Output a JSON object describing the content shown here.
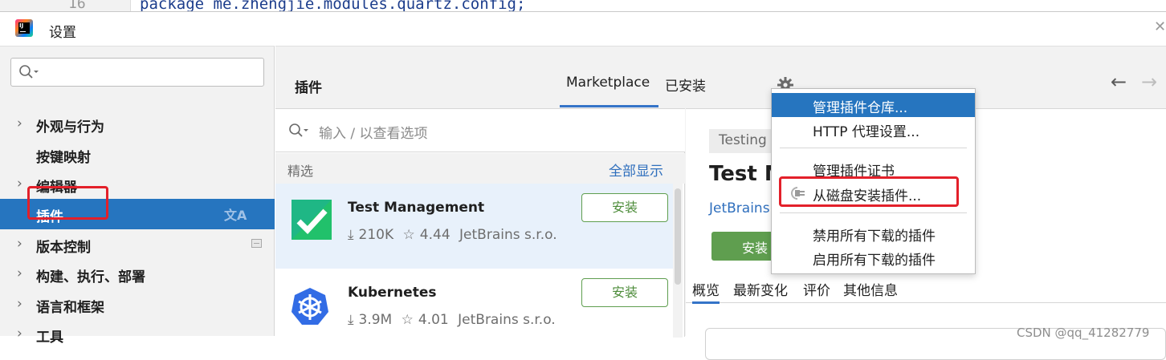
{
  "editor": {
    "line_number": "16",
    "code_line": "package me.zhengjie.modules.quartz.config;"
  },
  "window": {
    "title": "设置",
    "app_icon": "intellij-idea-icon",
    "app_icon_text": "IJ"
  },
  "sidebar": {
    "search_icon": "search-icon",
    "items": [
      {
        "label": "外观与行为",
        "expandable": true
      },
      {
        "label": "按键映射",
        "expandable": false
      },
      {
        "label": "编辑器",
        "expandable": true
      },
      {
        "label": "插件",
        "expandable": false,
        "selected": true
      },
      {
        "label": "版本控制",
        "expandable": true
      },
      {
        "label": "构建、执行、部署",
        "expandable": true
      },
      {
        "label": "语言和框架",
        "expandable": true
      },
      {
        "label": "工具",
        "expandable": true
      }
    ]
  },
  "plugins": {
    "title": "插件",
    "tabs": [
      {
        "label": "Marketplace",
        "active": true
      },
      {
        "label": "已安装",
        "active": false
      }
    ],
    "search_placeholder": "输入 / 以查看选项",
    "section_title": "精选",
    "section_link": "全部显示",
    "list": [
      {
        "name": "Test Management",
        "downloads": "210K",
        "rating": "4.44",
        "vendor": "JetBrains s.r.o.",
        "button": "安装"
      },
      {
        "name": "Kubernetes",
        "downloads": "3.9M",
        "rating": "4.01",
        "vendor": "JetBrains s.r.o.",
        "button": "安装"
      }
    ],
    "detail": {
      "tag": "Testing",
      "title": "Test M",
      "vendor": "JetBrains",
      "install": "安装",
      "tabs": [
        "概览",
        "最新变化",
        "评价",
        "其他信息"
      ]
    }
  },
  "menu": {
    "items": [
      {
        "label": "管理插件仓库...",
        "active": true
      },
      {
        "label": "HTTP 代理设置...",
        "active": false
      },
      {
        "label": "管理插件证书",
        "active": false
      },
      {
        "label": "从磁盘安装插件...",
        "active": false,
        "icon": "plug-icon"
      },
      {
        "label": "禁用所有下载的插件",
        "active": false
      },
      {
        "label": "启用所有下载的插件",
        "active": false
      }
    ]
  },
  "colors": {
    "selection": "#2675bf",
    "highlight_box": "#e3202a",
    "install_green": "#5f9e4f",
    "link_blue": "#2f6fbd"
  },
  "watermark": "CSDN @qq_41282779"
}
